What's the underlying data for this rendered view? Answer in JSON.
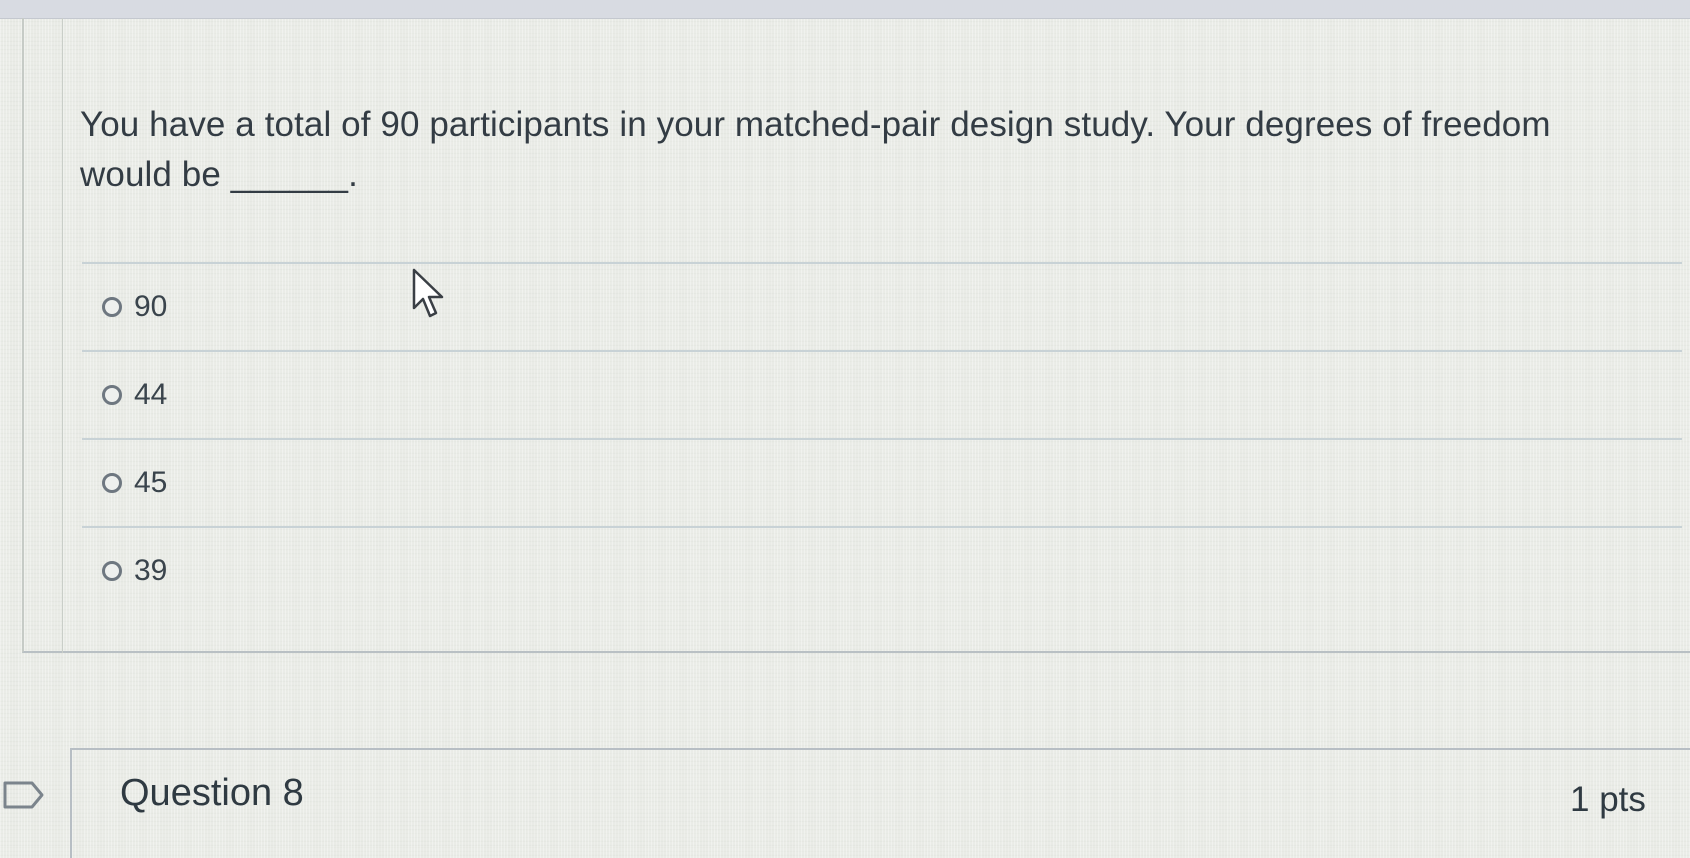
{
  "question": {
    "text": "You have a total of 90 participants in your matched-pair design study. Your degrees of freedom would be ______.",
    "answers": [
      {
        "label": "90",
        "selected": false
      },
      {
        "label": "44",
        "selected": false
      },
      {
        "label": "45",
        "selected": false
      },
      {
        "label": "39",
        "selected": false
      }
    ]
  },
  "next_question": {
    "title": "Question 8",
    "points": "1 pts"
  },
  "icons": {
    "cursor": "arrow-cursor-icon",
    "flag": "bookmark-flag-icon"
  },
  "colors": {
    "text": "#333c44",
    "radio_border": "#6e7780",
    "divider": "#c8d2d6"
  }
}
